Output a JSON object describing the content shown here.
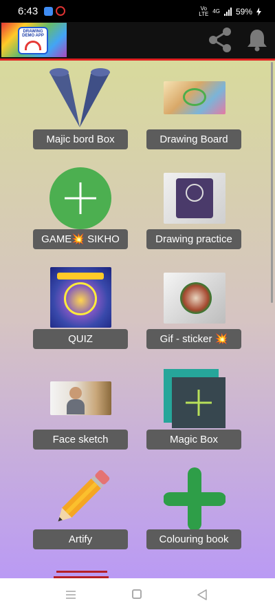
{
  "status_bar": {
    "time": "6:43",
    "network_top": "Vo",
    "network_bottom": "LTE",
    "net_type": "4G",
    "battery": "59%"
  },
  "app_bar": {
    "logo_text": "DRAWING DEMO APP"
  },
  "tiles": [
    {
      "label": "Majic bord Box"
    },
    {
      "label": "Drawing Board"
    },
    {
      "label": "GAME💥 SIKHO"
    },
    {
      "label": "Drawing practice"
    },
    {
      "label": "QUIZ"
    },
    {
      "label": "Gif - sticker 💥"
    },
    {
      "label": "Face sketch"
    },
    {
      "label": "Magic Box"
    },
    {
      "label": "Artify"
    },
    {
      "label": "Colouring book"
    }
  ],
  "colors": {
    "accent_red": "#e02020",
    "green": "#4caf50",
    "plus_green": "#2e9e48",
    "label_bg": "#5c5c5c"
  }
}
